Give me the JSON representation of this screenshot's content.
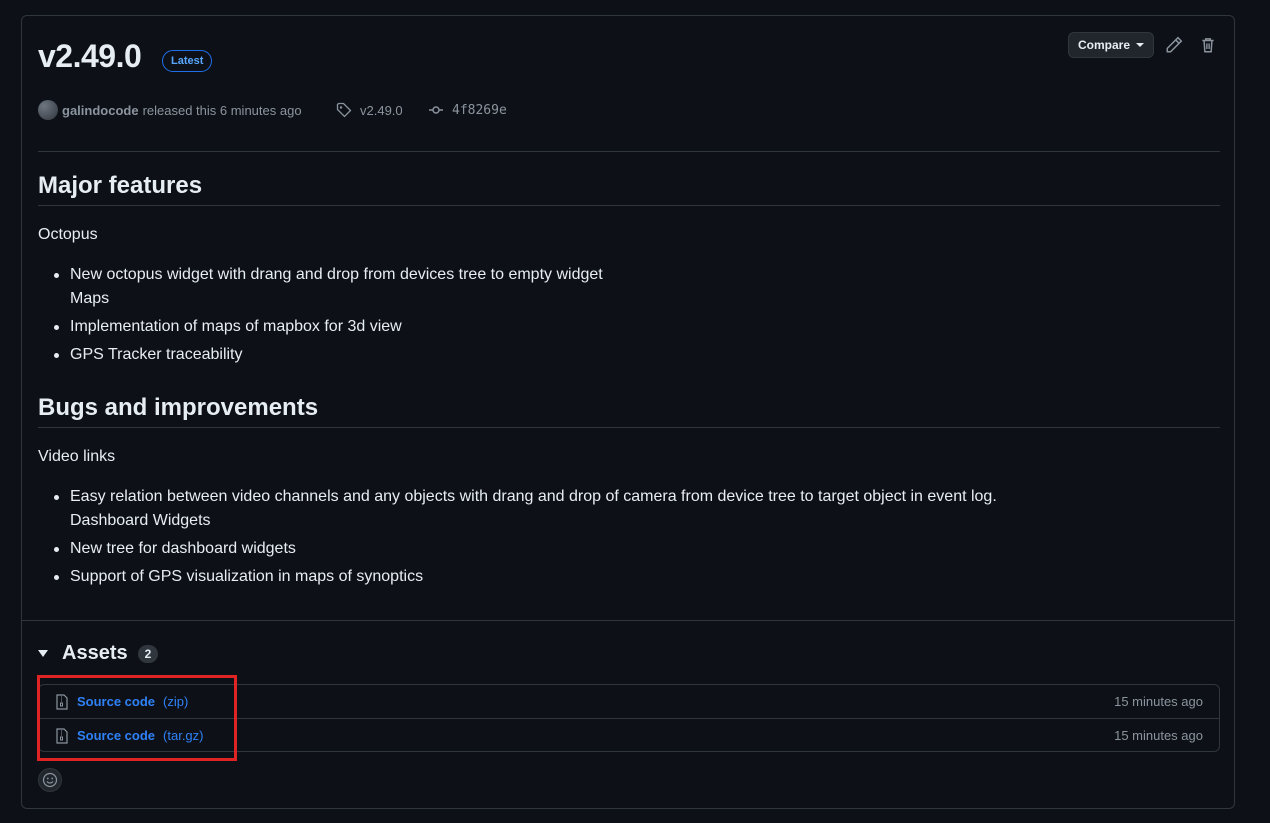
{
  "release": {
    "title": "v2.49.0",
    "badge": "Latest",
    "compare_label": "Compare",
    "author": "galindocode",
    "released_text": "released this 6 minutes ago",
    "tag": "v2.49.0",
    "commit": "4f8269e"
  },
  "notes": {
    "sections": [
      {
        "heading": "Major features",
        "intro": "Octopus",
        "items": [
          {
            "text": "New octopus widget with drang and drop from devices tree to empty widget",
            "sub": "Maps"
          },
          {
            "text": "Implementation of maps of mapbox for 3d view"
          },
          {
            "text": "GPS Tracker traceability"
          }
        ]
      },
      {
        "heading": "Bugs and improvements",
        "intro": "Video links",
        "items": [
          {
            "text": "Easy relation between video channels and any objects with drang and drop of camera from device tree to target object in event log.",
            "sub": "Dashboard Widgets"
          },
          {
            "text": "New tree for dashboard widgets"
          },
          {
            "text": "Support of GPS visualization in maps of synoptics"
          }
        ]
      }
    ]
  },
  "assets": {
    "title": "Assets",
    "count": "2",
    "items": [
      {
        "name": "Source code",
        "ext": "(zip)",
        "time": "15 minutes ago"
      },
      {
        "name": "Source code",
        "ext": "(tar.gz)",
        "time": "15 minutes ago"
      }
    ]
  },
  "colors": {
    "background": "#0d1117",
    "link": "#2f81f7",
    "highlight": "#e02424"
  }
}
